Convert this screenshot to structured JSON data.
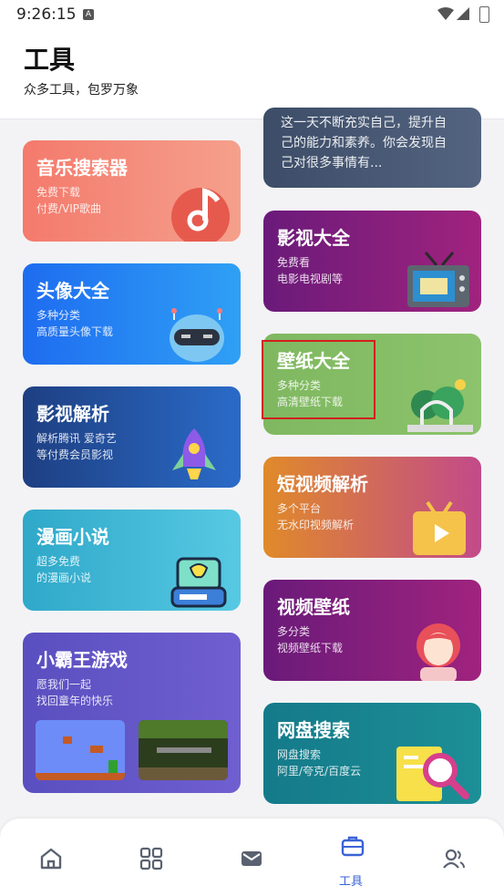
{
  "status": {
    "time": "9:26:15",
    "notif": "A"
  },
  "header": {
    "title": "工具",
    "subtitle": "众多工具，包罗万象"
  },
  "left_cards": [
    {
      "title": "音乐搜索器",
      "line1": "免费下载",
      "line2": "付费/VIP歌曲"
    },
    {
      "title": "头像大全",
      "line1": "多种分类",
      "line2": "高质量头像下载"
    },
    {
      "title": "影视解析",
      "line1": "解析腾讯 爱奇艺",
      "line2": "等付费会员影视"
    },
    {
      "title": "漫画小说",
      "line1": "超多免费",
      "line2": "的漫画小说"
    },
    {
      "title": "小霸王游戏",
      "line1": "愿我们一起",
      "line2": "找回童年的快乐"
    }
  ],
  "right_cards": [
    {
      "line0": "这一天不断充实自己，提升自",
      "line1": "己的能力和素养。你会发现自",
      "line2": "己对很多事情有..."
    },
    {
      "title": "影视大全",
      "line1": "免费看",
      "line2": "电影电视剧等"
    },
    {
      "title": "壁纸大全",
      "line1": "多种分类",
      "line2": "高清壁纸下载"
    },
    {
      "title": "短视频解析",
      "line1": "多个平台",
      "line2": "无水印视频解析"
    },
    {
      "title": "视频壁纸",
      "line1": "多分类",
      "line2": "视频壁纸下载"
    },
    {
      "title": "网盘搜索",
      "line1": "网盘搜索",
      "line2": "阿里/夸克/百度云"
    }
  ],
  "nav": {
    "active_label": "工具"
  },
  "colors": {
    "accent": "#3a63d6",
    "highlight": "#d21f1f"
  }
}
